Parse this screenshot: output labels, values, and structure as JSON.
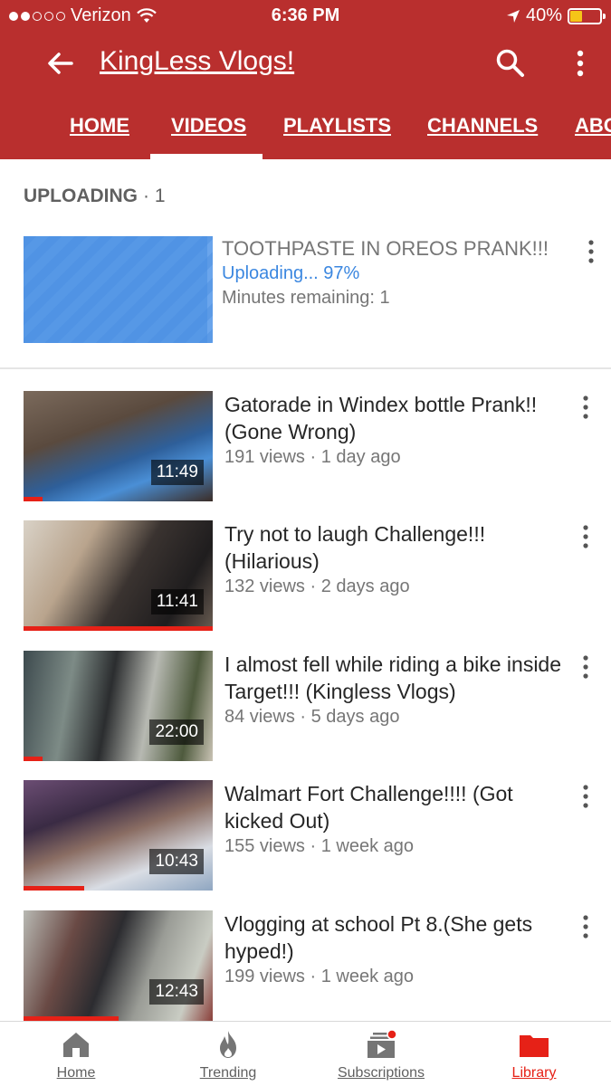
{
  "status_bar": {
    "carrier": "Verizon",
    "time": "6:36 PM",
    "battery": "40%",
    "battery_level": 0.4
  },
  "header": {
    "title": "KingLess Vlogs!"
  },
  "tabs": [
    {
      "label": "HOME"
    },
    {
      "label": "VIDEOS",
      "active": true
    },
    {
      "label": "PLAYLISTS"
    },
    {
      "label": "CHANNELS"
    },
    {
      "label": "ABOUT"
    }
  ],
  "uploading": {
    "heading": "UPLOADING",
    "count": "· 1",
    "title": "TOOTHPASTE IN OREOS PRANK!!!",
    "status": "Uploading... 97%",
    "progress": 0.97,
    "remaining": "Minutes remaining: 1"
  },
  "videos": [
    {
      "title": "Gatorade in Windex bottle Prank!! (Gone Wrong)",
      "meta": "191 views · 1 day ago",
      "duration": "11:49",
      "watched": 0.1
    },
    {
      "title": "Try not to laugh Challenge!!! (Hilarious)",
      "meta": "132 views · 2 days ago",
      "duration": "11:41",
      "watched": 1.0
    },
    {
      "title": "I almost fell while riding a bike inside Target!!! (Kingless Vlogs)",
      "meta": "84 views · 5 days ago",
      "duration": "22:00",
      "watched": 0.1
    },
    {
      "title": "Walmart Fort Challenge!!!! (Got kicked Out)",
      "meta": "155 views · 1 week ago",
      "duration": "10:43",
      "watched": 0.32
    },
    {
      "title": "Vlogging at school Pt 8.(She gets hyped!)",
      "meta": "199 views · 1 week ago",
      "duration": "12:43",
      "watched": 0.5
    }
  ],
  "bottom_nav": [
    {
      "label": "Home",
      "icon": "home-icon"
    },
    {
      "label": "Trending",
      "icon": "flame-icon"
    },
    {
      "label": "Subscriptions",
      "icon": "subscriptions-icon"
    },
    {
      "label": "Library",
      "icon": "folder-icon",
      "active": true
    }
  ],
  "colors": {
    "brand_red": "#b92f2e",
    "accent_red": "#e62117",
    "upload_blue": "#3b87e0"
  }
}
